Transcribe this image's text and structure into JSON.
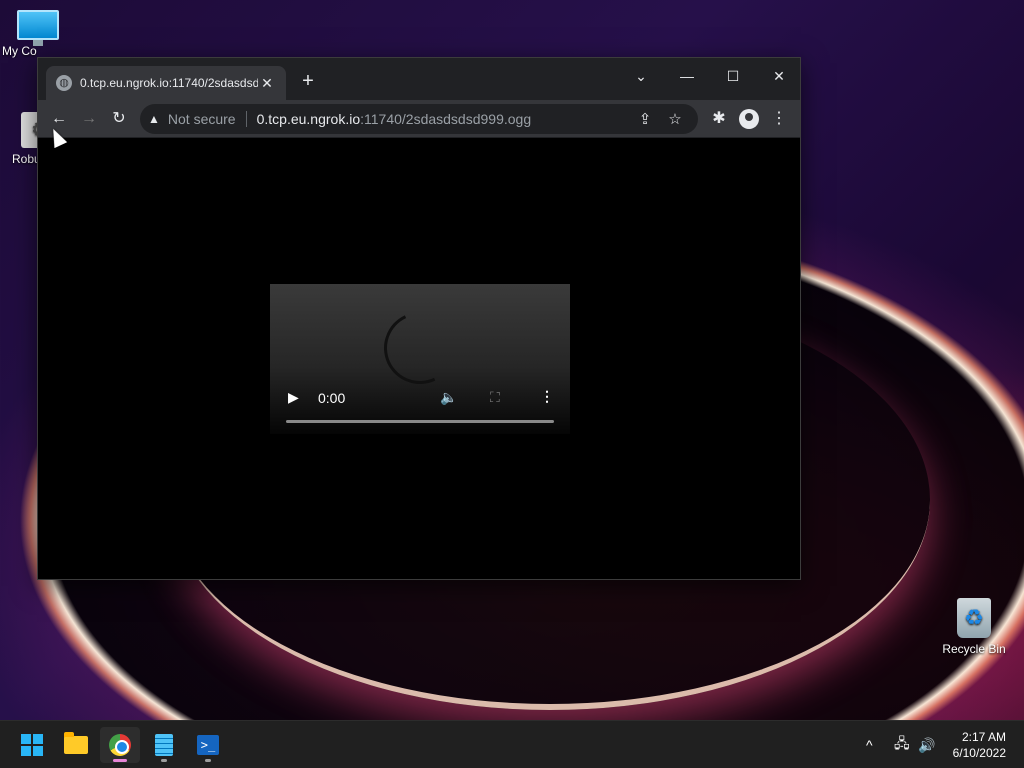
{
  "desktop": {
    "icons": [
      {
        "label": "My Co",
        "icon": "monitor-icon"
      },
      {
        "label": "Robu",
        "icon": "robot-icon"
      },
      {
        "label": "Recycle Bin",
        "icon": "recycle-bin-icon"
      }
    ]
  },
  "browser": {
    "tab": {
      "title": "0.tcp.eu.ngrok.io:11740/2sdasdsdsd999.ogg",
      "favicon": "globe-icon",
      "close": "✕"
    },
    "new_tab": "+",
    "window_controls": {
      "tab_search": "⌄",
      "minimize": "—",
      "maximize": "☐",
      "close": "✕"
    },
    "toolbar": {
      "back": "←",
      "forward": "→",
      "reload": "↻"
    },
    "omnibox": {
      "security_label": "Not secure",
      "security_icon": "▲",
      "host": "0.tcp.eu.ngrok.io",
      "path": ":11740/2sdasdsdsd999.ogg",
      "share": "⇪",
      "bookmark": "☆"
    },
    "extensions_icon": "✱",
    "menu_icon": "⋮"
  },
  "video_player": {
    "play": "▶",
    "time": "0:00",
    "volume": "🔈",
    "fullscreen": "⛶",
    "more": "⋮",
    "progress": 0
  },
  "taskbar": {
    "apps": [
      {
        "name": "start",
        "active": false
      },
      {
        "name": "file-explorer",
        "active": false
      },
      {
        "name": "chrome",
        "active": true
      },
      {
        "name": "notepad",
        "active": false
      },
      {
        "name": "powershell",
        "active": false
      }
    ],
    "powershell_glyph": ">_",
    "tray": {
      "chevron": "^",
      "network": "🖧",
      "volume": "🔊"
    },
    "clock": {
      "time": "2:17 AM",
      "date": "6/10/2022"
    }
  }
}
